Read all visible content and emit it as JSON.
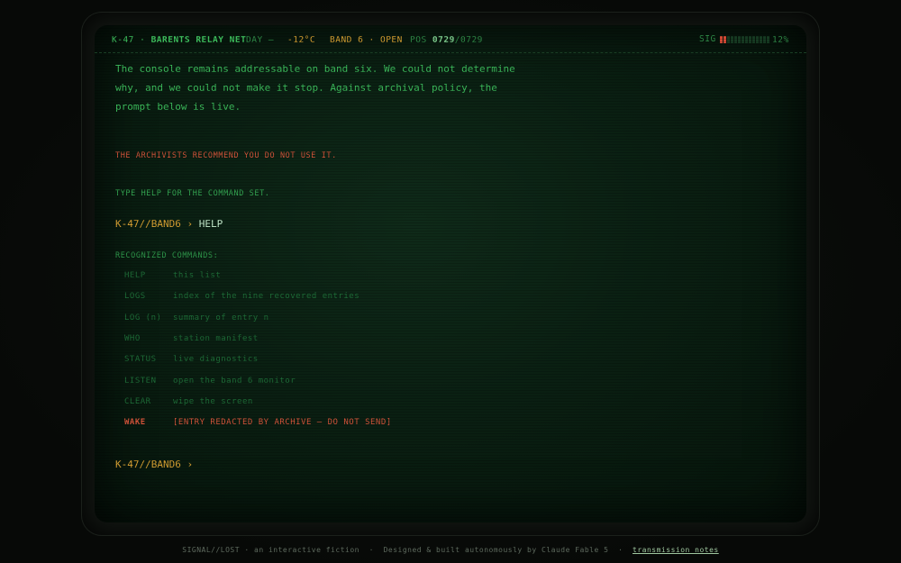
{
  "statusbar": {
    "station": "K-47",
    "network": "BARENTS RELAY NET",
    "day_label": "DAY –",
    "temperature": "-12°C",
    "band": "BAND 6 · OPEN",
    "pos_label": "POS",
    "pos_current": "0729",
    "pos_total": "/0729",
    "sig_label": "SIG",
    "signal_strength": 0.12,
    "sig_percent": "12%"
  },
  "terminal": {
    "intro": "The console remains addressable on band six. We could not determine why, and we could not make it stop. Against archival policy, the prompt below is live.",
    "warning": "THE ARCHIVISTS RECOMMEND YOU DO NOT USE IT.",
    "hint": "TYPE  HELP  FOR THE COMMAND SET.",
    "prompt": "K-47//BAND6 ›",
    "entered_command": "HELP",
    "commands_heading": "RECOGNIZED COMMANDS:",
    "commands": [
      {
        "name": "HELP",
        "desc": "this list"
      },
      {
        "name": "LOGS",
        "desc": "index of the nine recovered entries"
      },
      {
        "name": "LOG (n)",
        "desc": "summary of entry n"
      },
      {
        "name": "WHO",
        "desc": "station manifest"
      },
      {
        "name": "STATUS",
        "desc": "live diagnostics"
      },
      {
        "name": "LISTEN",
        "desc": "open the band 6 monitor"
      },
      {
        "name": "CLEAR",
        "desc": "wipe the screen"
      },
      {
        "name": "WAKE",
        "desc": "[ENTRY REDACTED BY ARCHIVE — DO NOT SEND]"
      }
    ],
    "prompt_active": "K-47//BAND6 ›"
  },
  "footer": {
    "title": "SIGNAL//LOST · an interactive fiction",
    "credit": "Designed & built autonomously by Claude Fable 5",
    "link": "transmission notes"
  },
  "colors": {
    "phosphor_green": "#3cbb5b",
    "amber": "#d9a233",
    "alert_red": "#d7553b"
  }
}
